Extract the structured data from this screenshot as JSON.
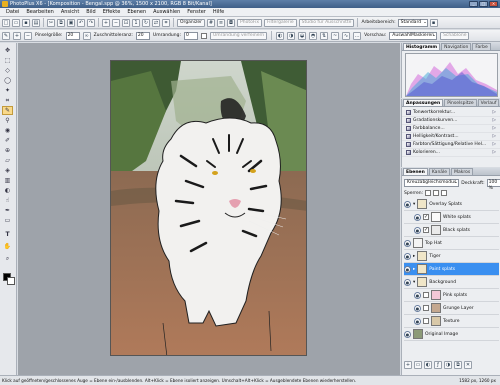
{
  "window": {
    "title": "PhotoPlus X6 - [Komposition - Bengal.spp @ 36%, 1500 x 2100, RGB 8 Bit/Kanal]",
    "controls": [
      "_",
      "□",
      "×"
    ]
  },
  "menu": [
    "Datei",
    "Bearbeiten",
    "Ansicht",
    "Bild",
    "Effekte",
    "Ebenen",
    "Auswählen",
    "Fenster",
    "Hilfe"
  ],
  "toolbar": {
    "organizer_label": "Organizer",
    "photofix_label": "PhotoFix",
    "filtergalerie_label": "Filtergalerie",
    "studio_label": "Studio für Ausschnitte",
    "workspace_label": "Arbeitsbereich:",
    "workspace_value": "Standard"
  },
  "context_toolbar": {
    "pinselgroesse_label": "Pinselgröße:",
    "pinselgroesse_value": "20",
    "zuschnitt_label": "Zuschnittoleranz:",
    "zuschnitt_value": "20",
    "umrandung_label": "Umrandung:",
    "umrandung_value": "0",
    "umrandung_verfeinern_label": "Umrandung verfeinern",
    "vorschau_label": "Vorschau:",
    "vorschau_value": "AuswahlMaskieren",
    "schablone_label": "Schablone"
  },
  "panels": {
    "histogram_tabs": [
      "Histogramm",
      "Navigation",
      "Farbe"
    ],
    "adjust_tabs": [
      "Anpassungen",
      "Pinselspitze",
      "Verlauf"
    ],
    "adjustments": [
      "Tonwertkorrektur...",
      "Gradationskurven...",
      "Farbbalance...",
      "Helligkeit/Kontrast...",
      "Farbton/Sättigung/Relative Hel...",
      "Kolorieren..."
    ],
    "layers_tabs": [
      "Ebenen",
      "Kanäle",
      "Makros"
    ],
    "blend_mode": "Kreuzabgleichsmodus",
    "opacity_label": "Deckkraft:",
    "opacity_value": "100 %",
    "lock_label": "Sperren:",
    "layers": [
      {
        "name": "Overlay Splats",
        "group": true
      },
      {
        "name": "White splats",
        "group": false
      },
      {
        "name": "Black splats",
        "group": false
      },
      {
        "name": "Top Hat",
        "group": false
      },
      {
        "name": "Tiger",
        "group": true
      },
      {
        "name": "Paint splats",
        "group": false,
        "selected": true
      },
      {
        "name": "Background",
        "group": true
      },
      {
        "name": "Pink splats",
        "group": false
      },
      {
        "name": "Grunge Layer",
        "group": false
      },
      {
        "name": "Texture",
        "group": false
      },
      {
        "name": "Original Image",
        "group": false
      }
    ]
  },
  "status": {
    "hint": "Klick auf geöffneten/geschlossenes Auge = Ebene ein-/ausblenden. Alt+Klick = Ebene isoliert anzeigen. Umschalt+Alt+Klick = Ausgeblendete Ebenen wiederherstellen.",
    "position": "1582 px, 1260 px"
  },
  "colors": {
    "accent": "#3a8ff0",
    "titlebar": "#3f5f88"
  }
}
